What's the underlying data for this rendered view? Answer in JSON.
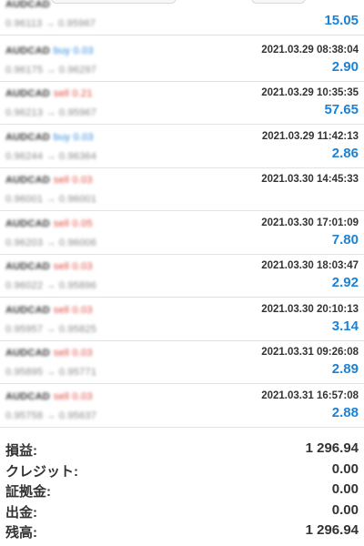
{
  "trades": [
    {
      "pair": "AUDCAD",
      "side": "",
      "side_type": "",
      "prices": "0.96113 → 0.95967",
      "time": "",
      "profit": "15.05"
    },
    {
      "pair": "AUDCAD",
      "side": "buy 0.03",
      "side_type": "buy",
      "prices": "0.96175 → 0.96297",
      "time": "2021.03.29 08:38:04",
      "profit": "2.90"
    },
    {
      "pair": "AUDCAD",
      "side": "sell 0.21",
      "side_type": "sell",
      "prices": "0.96213 → 0.95967",
      "time": "2021.03.29 10:35:35",
      "profit": "57.65"
    },
    {
      "pair": "AUDCAD",
      "side": "buy 0.03",
      "side_type": "buy",
      "prices": "0.96244 → 0.96364",
      "time": "2021.03.29 11:42:13",
      "profit": "2.86"
    },
    {
      "pair": "AUDCAD",
      "side": "sell 0.03",
      "side_type": "sell",
      "prices": "0.96001 → 0.96001",
      "time": "2021.03.30 14:45:33",
      "profit": ""
    },
    {
      "pair": "AUDCAD",
      "side": "sell 0.05",
      "side_type": "sell",
      "prices": "0.96203 → 0.96006",
      "time": "2021.03.30 17:01:09",
      "profit": "7.80"
    },
    {
      "pair": "AUDCAD",
      "side": "sell 0.03",
      "side_type": "sell",
      "prices": "0.96022 → 0.95896",
      "time": "2021.03.30 18:03:47",
      "profit": "2.92"
    },
    {
      "pair": "AUDCAD",
      "side": "sell 0.03",
      "side_type": "sell",
      "prices": "0.95957 → 0.95825",
      "time": "2021.03.30 20:10:13",
      "profit": "3.14"
    },
    {
      "pair": "AUDCAD",
      "side": "sell 0.03",
      "side_type": "sell",
      "prices": "0.95895 → 0.95771",
      "time": "2021.03.31 09:26:08",
      "profit": "2.89"
    },
    {
      "pair": "AUDCAD",
      "side": "sell 0.03",
      "side_type": "sell",
      "prices": "0.95758 → 0.95637",
      "time": "2021.03.31 16:57:08",
      "profit": "2.88"
    }
  ],
  "summary": [
    {
      "label": "損益:",
      "value": "1 296.94"
    },
    {
      "label": "クレジット:",
      "value": "0.00"
    },
    {
      "label": "証拠金:",
      "value": "0.00"
    },
    {
      "label": "出金:",
      "value": "0.00"
    },
    {
      "label": "残高:",
      "value": "1 296.94"
    }
  ],
  "colors": {
    "profit": "#1b82d6",
    "buy": "#2b86d9",
    "sell": "#e0453d",
    "divider": "#e3e3e3"
  }
}
